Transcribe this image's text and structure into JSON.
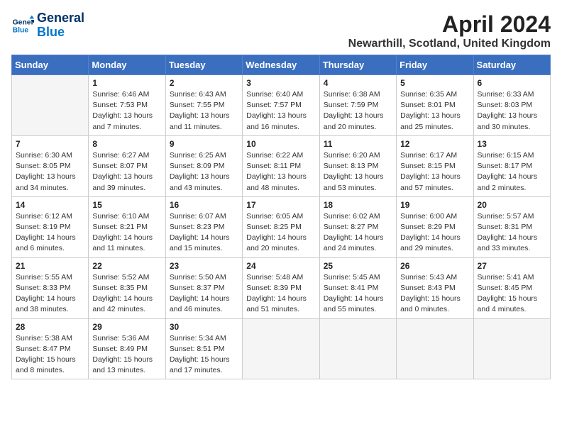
{
  "header": {
    "logo_line1": "General",
    "logo_line2": "Blue",
    "month_title": "April 2024",
    "location": "Newarthill, Scotland, United Kingdom"
  },
  "days_of_week": [
    "Sunday",
    "Monday",
    "Tuesday",
    "Wednesday",
    "Thursday",
    "Friday",
    "Saturday"
  ],
  "weeks": [
    [
      {
        "day": "",
        "info": ""
      },
      {
        "day": "1",
        "info": "Sunrise: 6:46 AM\nSunset: 7:53 PM\nDaylight: 13 hours\nand 7 minutes."
      },
      {
        "day": "2",
        "info": "Sunrise: 6:43 AM\nSunset: 7:55 PM\nDaylight: 13 hours\nand 11 minutes."
      },
      {
        "day": "3",
        "info": "Sunrise: 6:40 AM\nSunset: 7:57 PM\nDaylight: 13 hours\nand 16 minutes."
      },
      {
        "day": "4",
        "info": "Sunrise: 6:38 AM\nSunset: 7:59 PM\nDaylight: 13 hours\nand 20 minutes."
      },
      {
        "day": "5",
        "info": "Sunrise: 6:35 AM\nSunset: 8:01 PM\nDaylight: 13 hours\nand 25 minutes."
      },
      {
        "day": "6",
        "info": "Sunrise: 6:33 AM\nSunset: 8:03 PM\nDaylight: 13 hours\nand 30 minutes."
      }
    ],
    [
      {
        "day": "7",
        "info": "Sunrise: 6:30 AM\nSunset: 8:05 PM\nDaylight: 13 hours\nand 34 minutes."
      },
      {
        "day": "8",
        "info": "Sunrise: 6:27 AM\nSunset: 8:07 PM\nDaylight: 13 hours\nand 39 minutes."
      },
      {
        "day": "9",
        "info": "Sunrise: 6:25 AM\nSunset: 8:09 PM\nDaylight: 13 hours\nand 43 minutes."
      },
      {
        "day": "10",
        "info": "Sunrise: 6:22 AM\nSunset: 8:11 PM\nDaylight: 13 hours\nand 48 minutes."
      },
      {
        "day": "11",
        "info": "Sunrise: 6:20 AM\nSunset: 8:13 PM\nDaylight: 13 hours\nand 53 minutes."
      },
      {
        "day": "12",
        "info": "Sunrise: 6:17 AM\nSunset: 8:15 PM\nDaylight: 13 hours\nand 57 minutes."
      },
      {
        "day": "13",
        "info": "Sunrise: 6:15 AM\nSunset: 8:17 PM\nDaylight: 14 hours\nand 2 minutes."
      }
    ],
    [
      {
        "day": "14",
        "info": "Sunrise: 6:12 AM\nSunset: 8:19 PM\nDaylight: 14 hours\nand 6 minutes."
      },
      {
        "day": "15",
        "info": "Sunrise: 6:10 AM\nSunset: 8:21 PM\nDaylight: 14 hours\nand 11 minutes."
      },
      {
        "day": "16",
        "info": "Sunrise: 6:07 AM\nSunset: 8:23 PM\nDaylight: 14 hours\nand 15 minutes."
      },
      {
        "day": "17",
        "info": "Sunrise: 6:05 AM\nSunset: 8:25 PM\nDaylight: 14 hours\nand 20 minutes."
      },
      {
        "day": "18",
        "info": "Sunrise: 6:02 AM\nSunset: 8:27 PM\nDaylight: 14 hours\nand 24 minutes."
      },
      {
        "day": "19",
        "info": "Sunrise: 6:00 AM\nSunset: 8:29 PM\nDaylight: 14 hours\nand 29 minutes."
      },
      {
        "day": "20",
        "info": "Sunrise: 5:57 AM\nSunset: 8:31 PM\nDaylight: 14 hours\nand 33 minutes."
      }
    ],
    [
      {
        "day": "21",
        "info": "Sunrise: 5:55 AM\nSunset: 8:33 PM\nDaylight: 14 hours\nand 38 minutes."
      },
      {
        "day": "22",
        "info": "Sunrise: 5:52 AM\nSunset: 8:35 PM\nDaylight: 14 hours\nand 42 minutes."
      },
      {
        "day": "23",
        "info": "Sunrise: 5:50 AM\nSunset: 8:37 PM\nDaylight: 14 hours\nand 46 minutes."
      },
      {
        "day": "24",
        "info": "Sunrise: 5:48 AM\nSunset: 8:39 PM\nDaylight: 14 hours\nand 51 minutes."
      },
      {
        "day": "25",
        "info": "Sunrise: 5:45 AM\nSunset: 8:41 PM\nDaylight: 14 hours\nand 55 minutes."
      },
      {
        "day": "26",
        "info": "Sunrise: 5:43 AM\nSunset: 8:43 PM\nDaylight: 15 hours\nand 0 minutes."
      },
      {
        "day": "27",
        "info": "Sunrise: 5:41 AM\nSunset: 8:45 PM\nDaylight: 15 hours\nand 4 minutes."
      }
    ],
    [
      {
        "day": "28",
        "info": "Sunrise: 5:38 AM\nSunset: 8:47 PM\nDaylight: 15 hours\nand 8 minutes."
      },
      {
        "day": "29",
        "info": "Sunrise: 5:36 AM\nSunset: 8:49 PM\nDaylight: 15 hours\nand 13 minutes."
      },
      {
        "day": "30",
        "info": "Sunrise: 5:34 AM\nSunset: 8:51 PM\nDaylight: 15 hours\nand 17 minutes."
      },
      {
        "day": "",
        "info": ""
      },
      {
        "day": "",
        "info": ""
      },
      {
        "day": "",
        "info": ""
      },
      {
        "day": "",
        "info": ""
      }
    ]
  ]
}
